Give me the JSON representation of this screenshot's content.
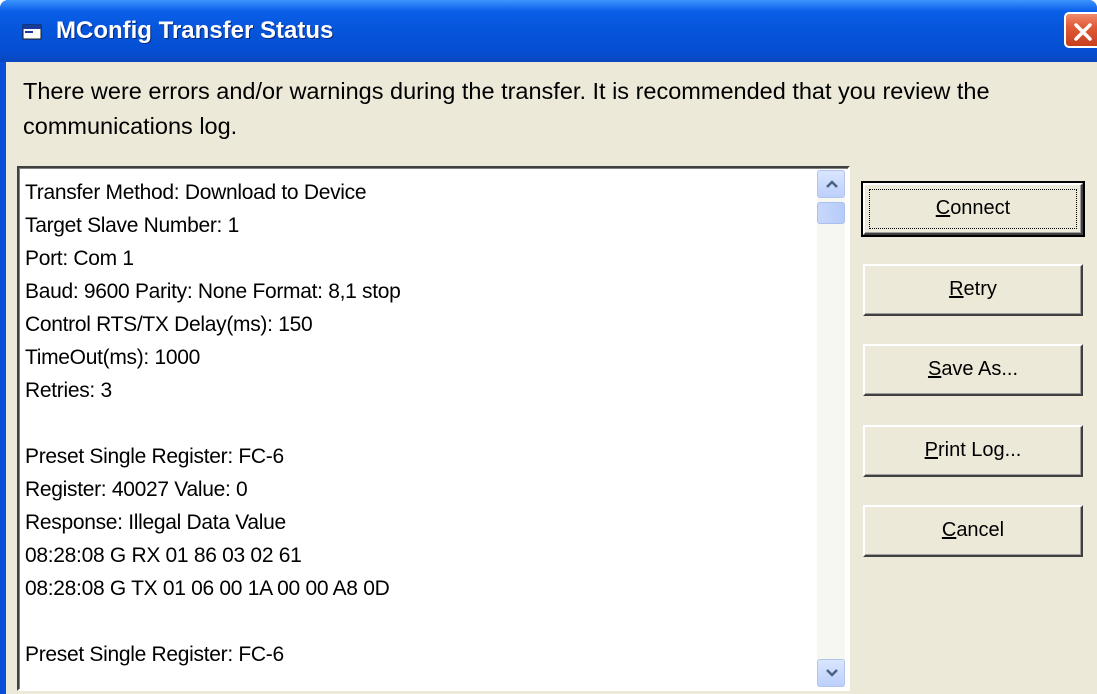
{
  "window": {
    "title": "MConfig Transfer Status",
    "close_icon": "close-icon"
  },
  "message": "There were errors and/or warnings during the transfer. It is recommended that you review the communications log.",
  "log": {
    "lines": [
      "Transfer Method: Download to Device",
      "Target Slave Number: 1",
      "Port: Com 1",
      "Baud: 9600 Parity: None Format: 8,1 stop",
      "Control RTS/TX Delay(ms): 150",
      "TimeOut(ms): 1000",
      "Retries: 3",
      "",
      "Preset Single Register: FC-6",
      "Register: 40027 Value: 0",
      "Response: Illegal Data Value",
      "08:28:08 G RX 01 86 03 02 61",
      "08:28:08 G TX 01 06 00 1A 00 00 A8 0D",
      "",
      "Preset Single Register: FC-6"
    ]
  },
  "buttons": {
    "connect": {
      "accel": "C",
      "rest": "onnect"
    },
    "retry": {
      "accel": "R",
      "rest": "etry"
    },
    "save_as": {
      "accel": "S",
      "rest": "ave As..."
    },
    "print_log": {
      "accel": "P",
      "rest": "rint Log..."
    },
    "cancel": {
      "accel": "C",
      "rest": "ancel"
    }
  },
  "colors": {
    "titlebar": "#0553d8",
    "client": "#ece9d8",
    "close_button": "#e05a36"
  }
}
